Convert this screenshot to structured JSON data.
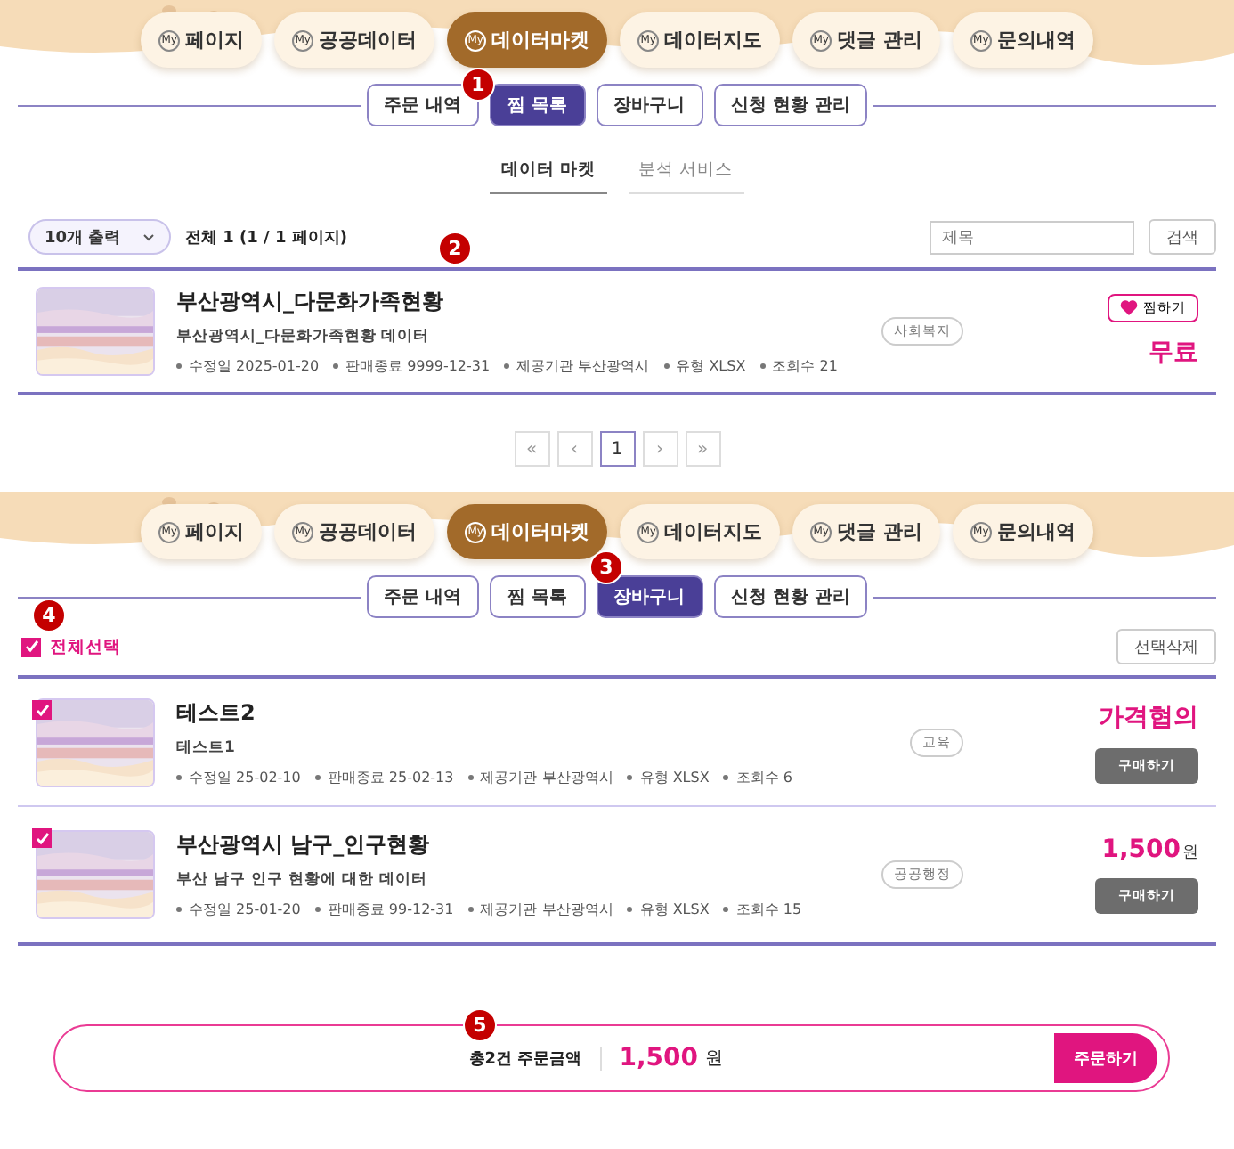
{
  "panels": [
    {
      "kind": "wishlist",
      "nav": [
        {
          "badge": "My",
          "label": "페이지",
          "selected": false
        },
        {
          "badge": "My",
          "label": "공공데이터",
          "selected": false
        },
        {
          "badge": "My",
          "label": "데이터마켓",
          "selected": true
        },
        {
          "badge": "My",
          "label": "데이터지도",
          "selected": false
        },
        {
          "badge": "My",
          "label": "댓글 관리",
          "selected": false
        },
        {
          "badge": "My",
          "label": "문의내역",
          "selected": false
        }
      ],
      "tabs": [
        {
          "label": "주문 내역",
          "selected": false
        },
        {
          "label": "찜 목록",
          "selected": true
        },
        {
          "label": "장바구니",
          "selected": false
        },
        {
          "label": "신청 현황 관리",
          "selected": false
        }
      ],
      "annotations": [
        "1",
        "2"
      ],
      "subtabs": [
        {
          "label": "데이터 마켓",
          "selected": true
        },
        {
          "label": "분석 서비스",
          "selected": false
        }
      ],
      "page_size": "10개 출력",
      "total": "전체 1 (1 / 1 페이지)",
      "search": {
        "placeholder": "제목",
        "button": "검색"
      },
      "items": [
        {
          "title": "부산광역시_다문화가족현황",
          "description": "부산광역시_다문화가족현황 데이터",
          "category": "사회복지",
          "meta": [
            {
              "label": "수정일",
              "value": "2025-01-20"
            },
            {
              "label": "판매종료",
              "value": "9999-12-31"
            },
            {
              "label": "제공기관",
              "value": "부산광역시"
            },
            {
              "label": "유형",
              "value": "XLSX"
            },
            {
              "label": "조회수",
              "value": "21"
            }
          ],
          "wish": "찜하기",
          "price": "무료"
        }
      ],
      "pagination": [
        {
          "label": "«",
          "selected": false
        },
        {
          "label": "‹",
          "selected": false
        },
        {
          "label": "1",
          "selected": true
        },
        {
          "label": "›",
          "selected": false
        },
        {
          "label": "»",
          "selected": false
        }
      ]
    },
    {
      "kind": "cart",
      "nav": [
        {
          "badge": "My",
          "label": "페이지",
          "selected": false
        },
        {
          "badge": "My",
          "label": "공공데이터",
          "selected": false
        },
        {
          "badge": "My",
          "label": "데이터마켓",
          "selected": true
        },
        {
          "badge": "My",
          "label": "데이터지도",
          "selected": false
        },
        {
          "badge": "My",
          "label": "댓글 관리",
          "selected": false
        },
        {
          "badge": "My",
          "label": "문의내역",
          "selected": false
        }
      ],
      "tabs": [
        {
          "label": "주문 내역",
          "selected": false
        },
        {
          "label": "찜 목록",
          "selected": false
        },
        {
          "label": "장바구니",
          "selected": true
        },
        {
          "label": "신청 현황 관리",
          "selected": false
        }
      ],
      "annotations": [
        "3",
        "4",
        "5"
      ],
      "select_all": {
        "label": "전체선택",
        "checked": true
      },
      "delete_button": "선택삭제",
      "items": [
        {
          "checked": true,
          "title": "테스트2",
          "description": "테스트1",
          "category": "교육",
          "meta": [
            {
              "label": "수정일",
              "value": "25-02-10"
            },
            {
              "label": "판매종료",
              "value": "25-02-13"
            },
            {
              "label": "제공기관",
              "value": "부산광역시"
            },
            {
              "label": "유형",
              "value": "XLSX"
            },
            {
              "label": "조회수",
              "value": "6"
            }
          ],
          "price": "가격협의",
          "buy": "구매하기"
        },
        {
          "checked": true,
          "title": "부산광역시 남구_인구현황",
          "description": "부산 남구 인구 현황에 대한 데이터",
          "category": "공공행정",
          "meta": [
            {
              "label": "수정일",
              "value": "25-01-20"
            },
            {
              "label": "판매종료",
              "value": "99-12-31"
            },
            {
              "label": "제공기관",
              "value": "부산광역시"
            },
            {
              "label": "유형",
              "value": "XLSX"
            },
            {
              "label": "조회수",
              "value": "15"
            }
          ],
          "price": "1,500",
          "price_unit": "원",
          "buy": "구매하기"
        }
      ],
      "summary": {
        "label": "총2건 주문금액",
        "amount": "1,500",
        "unit": "원",
        "button": "주문하기"
      }
    }
  ]
}
